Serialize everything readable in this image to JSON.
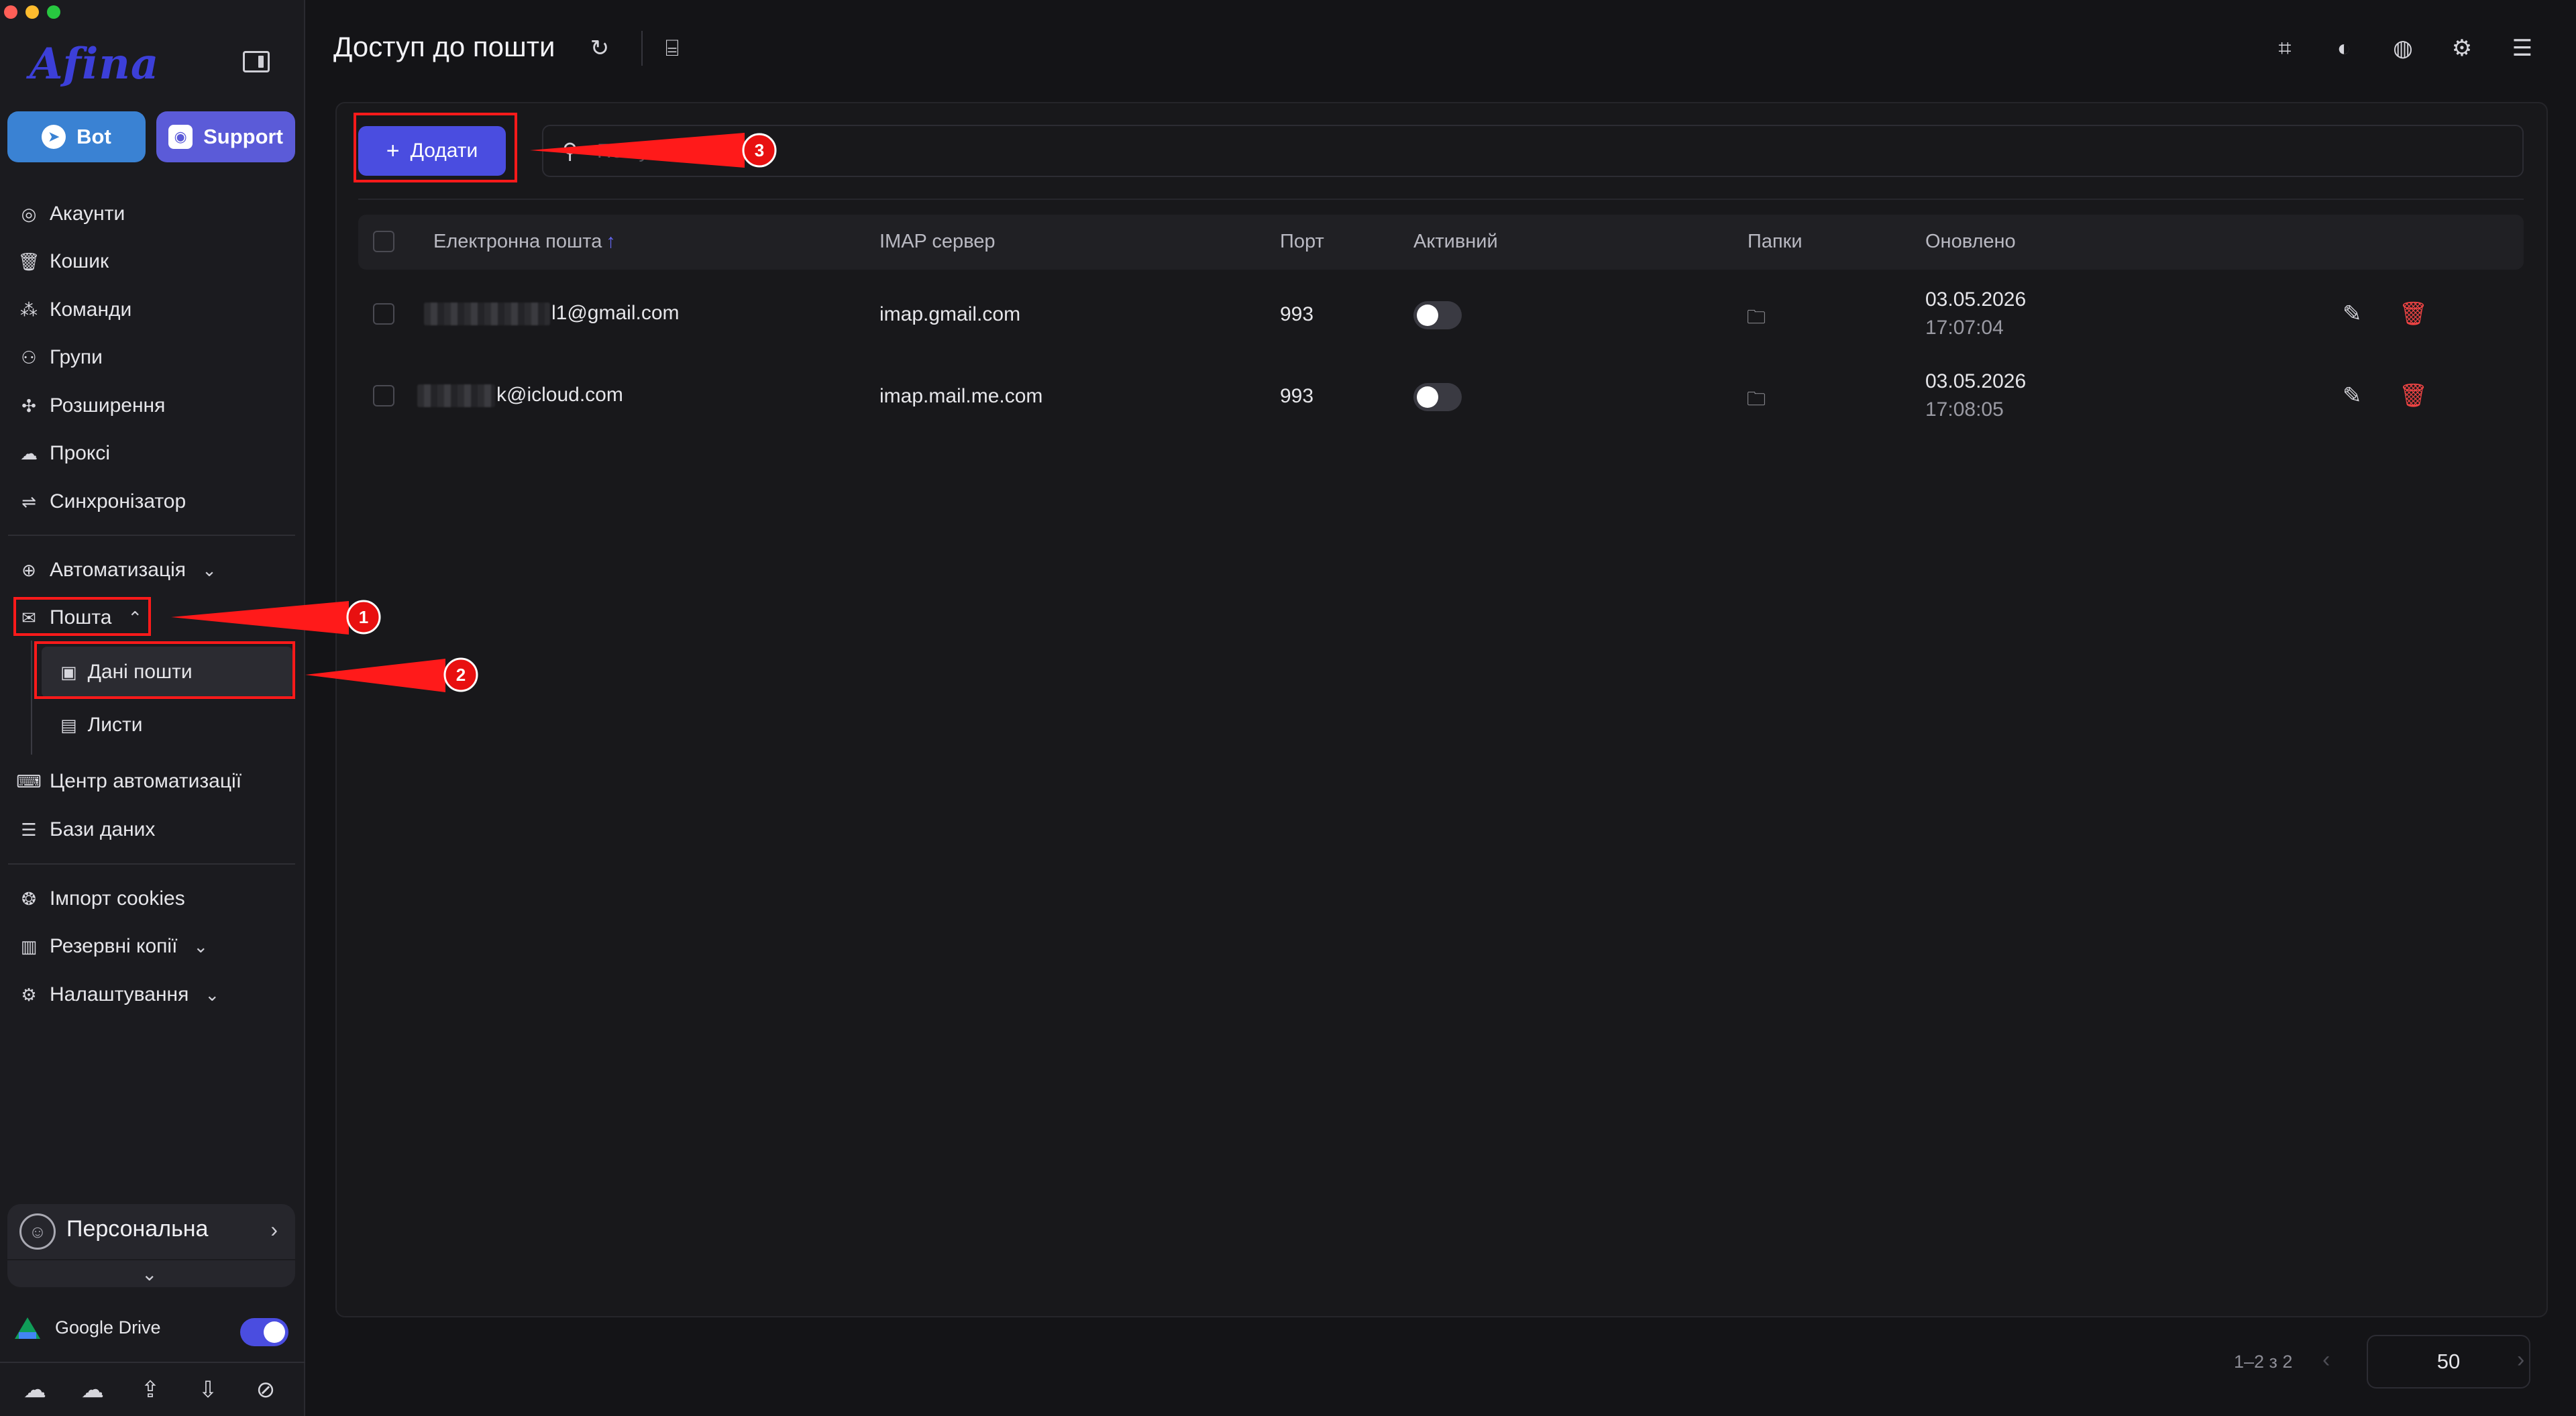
{
  "app": {
    "logo": "Afina"
  },
  "sidebar": {
    "bot_label": "Bot",
    "support_label": "Support",
    "items": [
      {
        "label": "Акаунти",
        "icon": "user-circle-icon"
      },
      {
        "label": "Кошик",
        "icon": "trash-icon"
      },
      {
        "label": "Команди",
        "icon": "team-icon"
      },
      {
        "label": "Групи",
        "icon": "group-icon"
      },
      {
        "label": "Розширення",
        "icon": "puzzle-icon"
      },
      {
        "label": "Проксі",
        "icon": "cloud-icon"
      },
      {
        "label": "Синхронізатор",
        "icon": "sync-icon"
      }
    ],
    "automation": {
      "label": "Автоматизація",
      "icon": "automation-icon"
    },
    "mail": {
      "label": "Пошта",
      "icon": "mail-icon",
      "children": [
        {
          "label": "Дані пошти",
          "icon": "id-card-icon",
          "active": true
        },
        {
          "label": "Листи",
          "icon": "inbox-icon",
          "active": false
        }
      ]
    },
    "items_after_mail": [
      {
        "label": "Центр автоматизації",
        "icon": "laptop-icon"
      },
      {
        "label": "Бази даних",
        "icon": "list-icon"
      }
    ],
    "items_bottom": [
      {
        "label": "Імпорт cookies",
        "icon": "cookie-icon"
      },
      {
        "label": "Резервні копії",
        "icon": "backup-icon"
      },
      {
        "label": "Налаштування",
        "icon": "gear-icon"
      }
    ],
    "profile": {
      "name": "Персональна"
    },
    "google_drive": {
      "label": "Google Drive",
      "enabled": true
    }
  },
  "header": {
    "title": "Доступ до пошти"
  },
  "toolbar": {
    "add_label": "Додати",
    "search_placeholder": "Пошук"
  },
  "table": {
    "columns": [
      "Електронна пошта",
      "IMAP сервер",
      "Порт",
      "Активний",
      "Папки",
      "Оновлено"
    ],
    "sort_column": "Електронна пошта",
    "sort_direction": "asc",
    "rows": [
      {
        "email_visible": "l1@gmail.com",
        "imap": "imap.gmail.com",
        "port": "993",
        "active": false,
        "updated_date": "03.05.2026",
        "updated_time": "17:07:04"
      },
      {
        "email_visible": "k@icloud.com",
        "imap": "imap.mail.me.com",
        "port": "993",
        "active": false,
        "updated_date": "03.05.2026",
        "updated_time": "17:08:05"
      }
    ]
  },
  "pagination": {
    "range_text": "1–2 з 2",
    "page_size": "50"
  },
  "annotations": {
    "badges": [
      "1",
      "2",
      "3"
    ],
    "color": "#ff1a1a"
  },
  "colors": {
    "accent": "#4a4de0",
    "danger": "#ef4444",
    "bot": "#3a82d3",
    "support": "#5b5bd8"
  }
}
